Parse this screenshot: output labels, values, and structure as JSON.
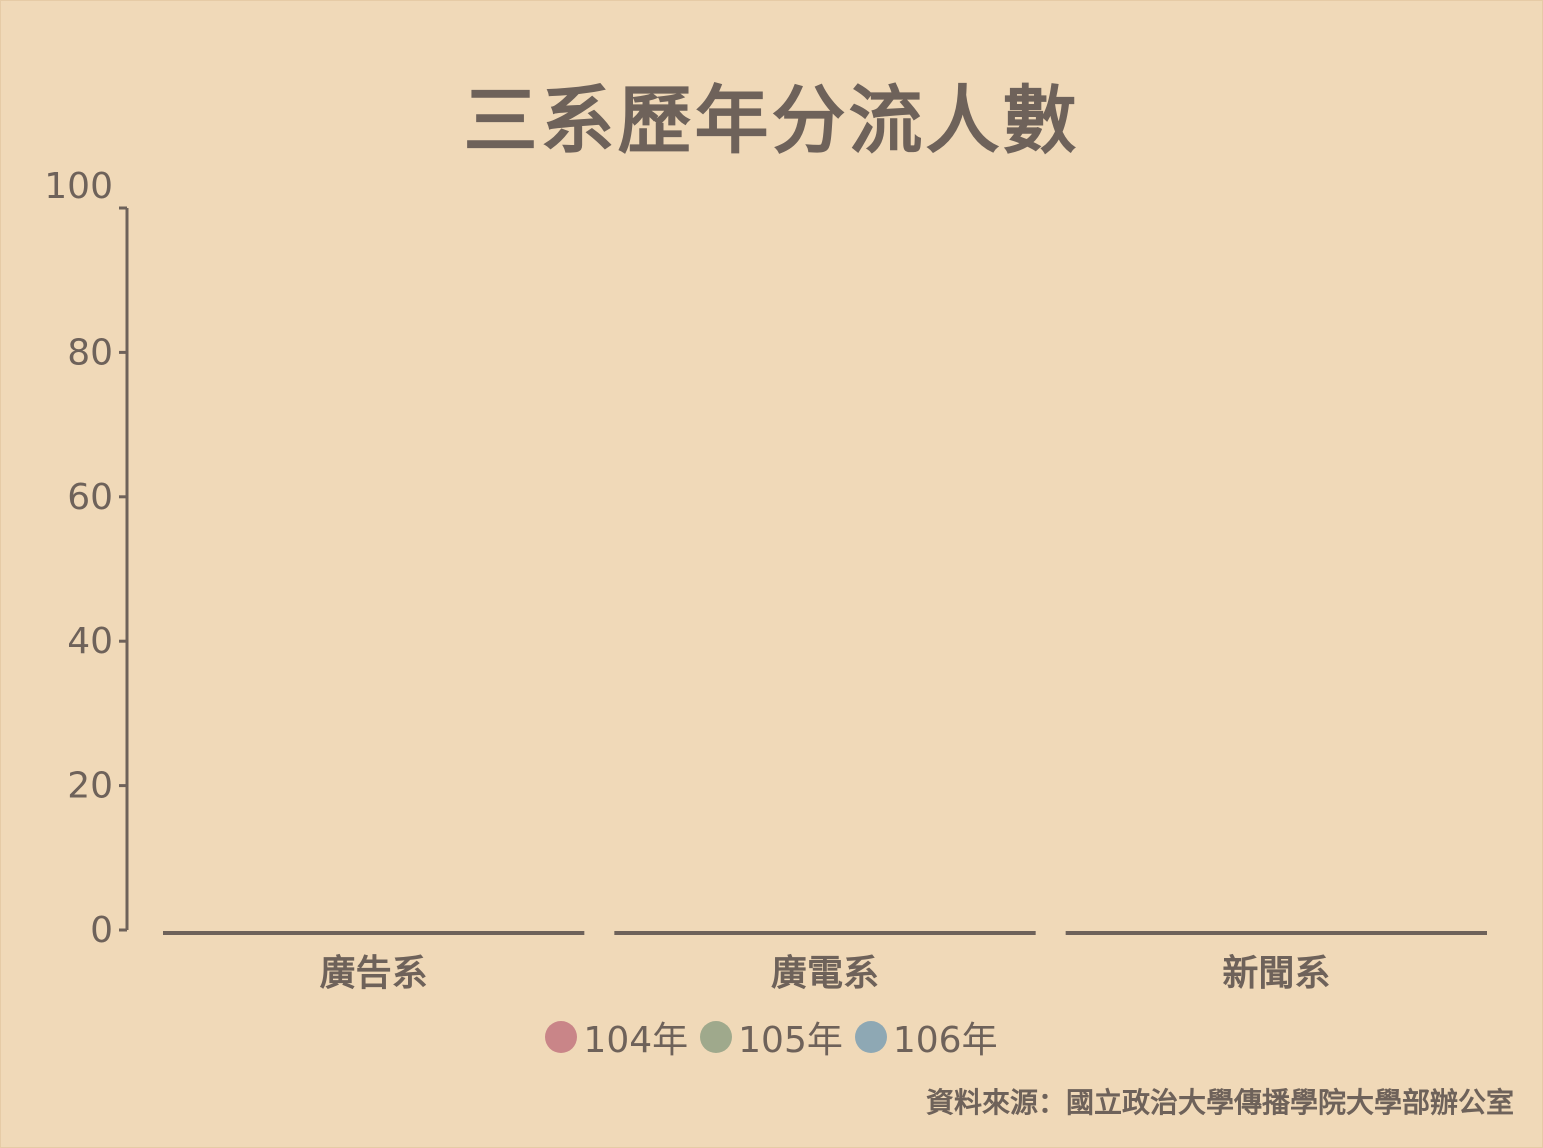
{
  "chart_data": {
    "type": "bar",
    "title": "三系歷年分流人數",
    "categories": [
      "廣告系",
      "廣電系",
      "新聞系"
    ],
    "series": [
      {
        "name": "104年",
        "color": "#c98588",
        "values": [
          0,
          0,
          0
        ]
      },
      {
        "name": "105年",
        "color": "#9fa98c",
        "values": [
          0,
          0,
          0
        ]
      },
      {
        "name": "106年",
        "color": "#8ea8b4",
        "values": [
          0,
          0,
          0
        ]
      }
    ],
    "ylim": [
      0,
      100
    ],
    "yticks": [
      "0",
      "20",
      "40",
      "60",
      "80",
      "100"
    ],
    "xlabel": "",
    "ylabel": "",
    "legend_position": "bottom-center",
    "grid": false,
    "source": "資料來源：國立政治大學傳播學院大學部辦公室"
  },
  "colors": {
    "background": "#f0d9b8",
    "text": "#6e625a",
    "axis": "#6e625a"
  }
}
